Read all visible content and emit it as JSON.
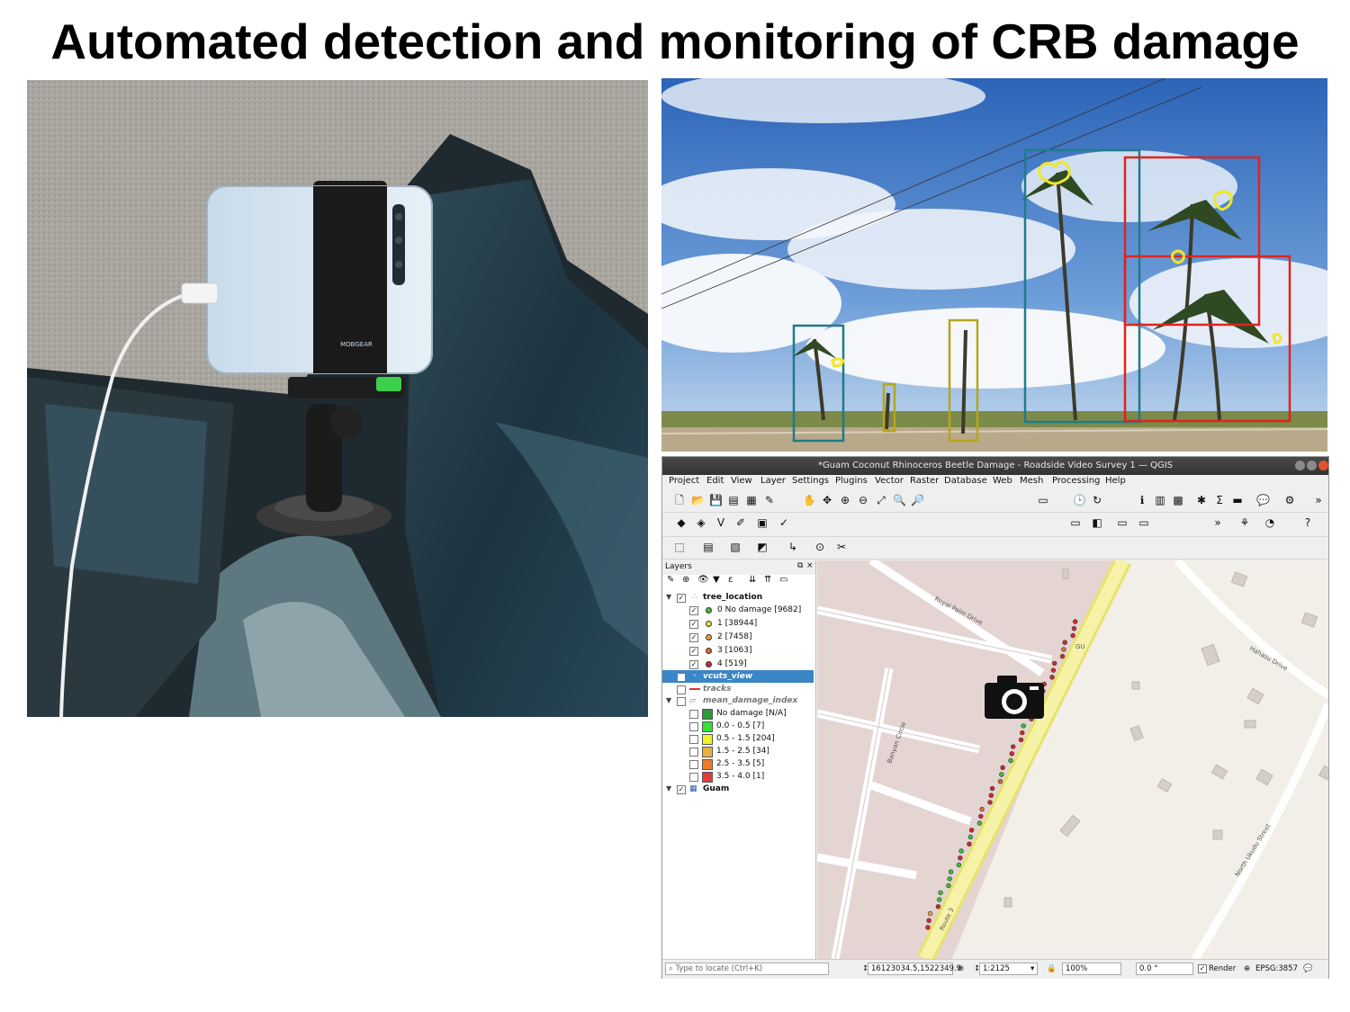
{
  "slide": {
    "title": "Automated detection and monitoring of CRB damage"
  },
  "photo_left": {
    "phone_brand": "MOBGEAR"
  },
  "detection_photo": {
    "box_colors": {
      "teal": "#1f7a8c",
      "red": "#e0241d",
      "olive": "#b7a51a",
      "damage_outline": "#f0e62a"
    }
  },
  "qgis": {
    "window_title": "*Guam Coconut Rhinoceros Beetle Damage - Roadside Video Survey 1 — QGIS",
    "menu": [
      "Project",
      "Edit",
      "View",
      "Layer",
      "Settings",
      "Plugins",
      "Vector",
      "Raster",
      "Database",
      "Web",
      "Mesh",
      "Processing",
      "Help"
    ],
    "layers_panel_title": "Layers",
    "layers": {
      "tree_location": "tree_location",
      "classes": [
        {
          "label": "0 No damage [9682]",
          "color": "#39c436"
        },
        {
          "label": "1 [38944]",
          "color": "#e8e33a"
        },
        {
          "label": "2 [7458]",
          "color": "#e6a43a"
        },
        {
          "label": "3 [1063]",
          "color": "#e06a33"
        },
        {
          "label": "4 [519]",
          "color": "#d42a2a"
        }
      ],
      "vcuts_view": "vcuts_view",
      "tracks": "tracks",
      "mean_damage_index": "mean_damage_index",
      "ranges": [
        {
          "label": "No damage [N/A]",
          "color": "#2e9a3a"
        },
        {
          "label": "0.0 - 0.5 [7]",
          "color": "#36e036"
        },
        {
          "label": "0.5 - 1.5 [204]",
          "color": "#f2f22a"
        },
        {
          "label": "1.5 - 2.5 [34]",
          "color": "#e8b13a"
        },
        {
          "label": "2.5 - 3.5 [5]",
          "color": "#ee7a2a"
        },
        {
          "label": "3.5 - 4.0 [1]",
          "color": "#e03c3c"
        }
      ],
      "guam": "Guam"
    },
    "map_labels": {
      "royal_palm": "Royal Palm Drive",
      "hahasu": "Hahasu Drive",
      "banyan": "Banyan Circle",
      "north_ukudu": "North Ukudu Street",
      "route3": "Route 3",
      "gu": "GU"
    },
    "statusbar": {
      "locate_placeholder": "Type to locate (Ctrl+K)",
      "coordinate": "16123034.5,1522349.9",
      "scale": "1:2125",
      "magnifier": "100%",
      "rotation": "0.0 °",
      "render": "Render",
      "crs": "EPSG:3857"
    }
  }
}
